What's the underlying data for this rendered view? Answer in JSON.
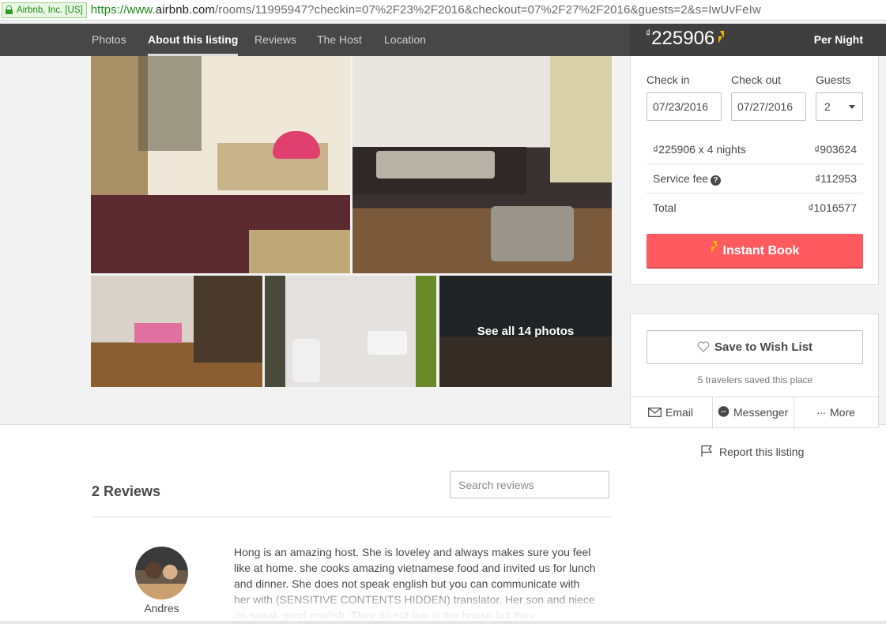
{
  "browser": {
    "identity_label": "Airbnb, Inc. [US]",
    "url_scheme": "https://www.",
    "url_domain": "airbnb.com",
    "url_path": "/rooms/11995947?checkin=07%2F23%2F2016&checkout=07%2F27%2F2016&guests=2&s=IwUvFeIw"
  },
  "nav": {
    "items": [
      "Photos",
      "About this listing",
      "Reviews",
      "The Host",
      "Location"
    ],
    "active": "About this listing"
  },
  "price": {
    "currency": "₫",
    "amount": "225906",
    "period": "Per Night"
  },
  "booking": {
    "checkin_label": "Check in",
    "checkout_label": "Check out",
    "guests_label": "Guests",
    "checkin_value": "07/23/2016",
    "checkout_value": "07/27/2016",
    "guests_value": "2",
    "breakdown": [
      {
        "label": "₫225906 x 4 nights",
        "value": "₫903624"
      },
      {
        "label": "Service fee",
        "value": "₫112953"
      },
      {
        "label": "Total",
        "value": "₫1016577"
      }
    ],
    "instant_book_label": "Instant Book"
  },
  "photos": {
    "see_all_label": "See all 14 photos"
  },
  "wishlist": {
    "button_label": "Save to Wish List",
    "saved_text": "5 travelers saved this place",
    "share": [
      "Email",
      "Messenger",
      "More"
    ]
  },
  "report_label": "Report this listing",
  "reviews": {
    "title": "2 Reviews",
    "search_placeholder": "Search reviews",
    "items": [
      {
        "reviewer": "Andres",
        "text": "Hong is an amazing host. She is loveley and always makes sure you feel like at home. she cooks amazing vietnamese food and invited us for lunch and dinner. She does not speak english but you can communicate with her with (SENSITIVE CONTENTS HIDDEN) translator. Her son and niece do speak good english. They do not live in the house but they"
      }
    ]
  },
  "colors": {
    "accent": "#ff5a5f",
    "nav_bg": "#474747",
    "bolt": "#f5b400"
  }
}
